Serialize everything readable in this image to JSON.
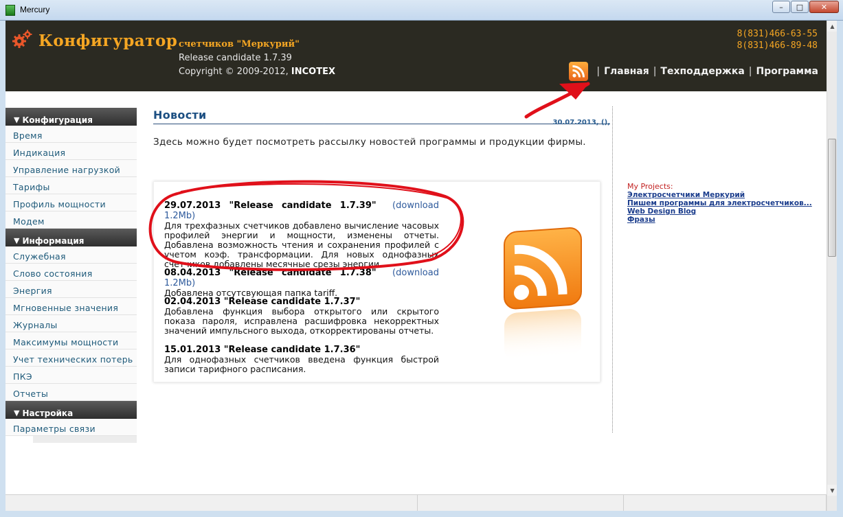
{
  "window": {
    "title": "Mercury",
    "buttons": {
      "minimize": "–",
      "maximize": "□",
      "close": "✕"
    }
  },
  "header": {
    "brand": "Конфигуратор",
    "subtitle": "счетчиков \"Меркурий\"",
    "release": "Release candidate 1.7.39",
    "copyright_prefix": "Copyright © 2009-2012, ",
    "copyright_company": "INCOTEX",
    "phone1": "8(831)466-63-55",
    "phone2": "8(831)466-89-48",
    "nav": [
      "Главная",
      "Техподдержка",
      "Программа"
    ],
    "separator": "|"
  },
  "sidebar": {
    "sections": [
      {
        "title": "Конфигурация",
        "items": [
          "Время",
          "Индикация",
          "Управление нагрузкой",
          "Тарифы",
          "Профиль мощности",
          "Модем"
        ]
      },
      {
        "title": "Информация",
        "items": [
          "Служебная",
          "Слово состояния",
          "Энергия",
          "Мгновенные значения",
          "Журналы",
          "Максимумы мощности",
          "Учет технических потерь",
          "ПКЭ",
          "Отчеты"
        ]
      },
      {
        "title": "Настройка",
        "items": [
          "Параметры связи"
        ]
      }
    ]
  },
  "main": {
    "title": "Новости",
    "date": "30.07.2013, (),",
    "intro": "Здесь можно будет посмотреть рассылку новостей программы и продукции фирмы.",
    "news": [
      {
        "heading": "29.07.2013 \"Release candidate 1.7.39\"",
        "download": "(download 1.2Mb)",
        "text": "Для трехфазных счетчиков добавлено вычисление часовых профилей энергии и мощности, изменены отчеты. Добавлена возможность чтения и сохранения профилей с учетом коэф. трансформации. Для новых однофазных счетчиков добавлены месячные срезы энергии."
      },
      {
        "heading": "08.04.2013 \"Release candidate 1.7.38\"",
        "download": "(download 1.2Mb)",
        "text": "Добавлена отсутсвующая папка tariff."
      },
      {
        "heading": "02.04.2013 \"Release candidate 1.7.37\"",
        "download": "",
        "text": "Добавлена функция выбора открытого или скрытого показа пароля, исправлена расшифровка некорректных значений импульсного выхода, откорректированы отчеты."
      },
      {
        "heading": "15.01.2013 \"Release candidate 1.7.36\"",
        "download": "",
        "text": "Для однофазных счетчиков введена функция быстрой записи тарифного расписания."
      }
    ]
  },
  "projects": {
    "title": "My Projects:",
    "links": [
      "Электросчетчики Меркурий",
      "Пишем программы для электросчетчиков...",
      "Web Design Blog",
      "Фразы"
    ]
  },
  "colors": {
    "header_bg": "#2b2a22",
    "brand": "#f5a623",
    "link": "#1c4f82",
    "highlight": "#e0101a"
  },
  "icons": [
    "gear-icon",
    "rss-icon",
    "rss-large-icon"
  ]
}
